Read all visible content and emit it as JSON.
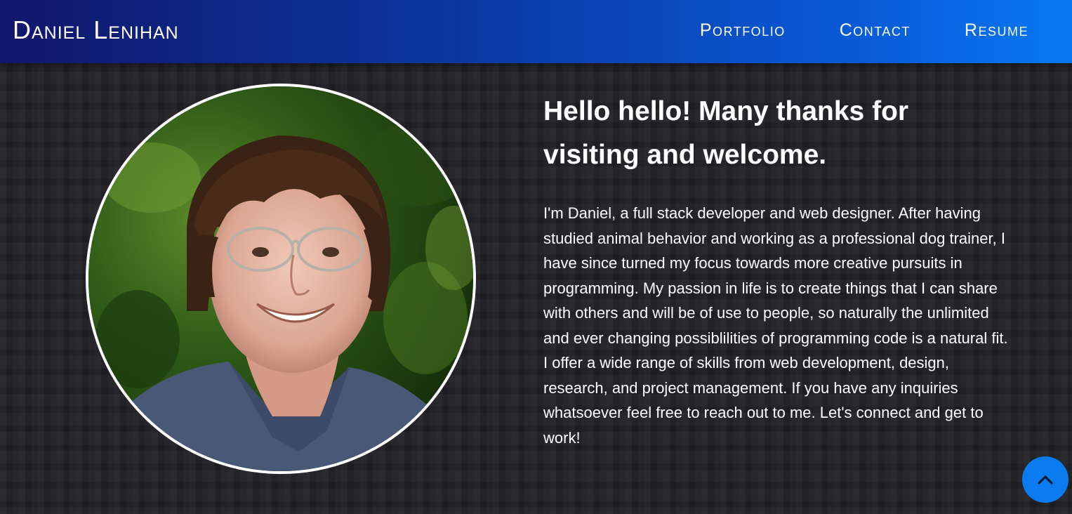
{
  "header": {
    "brand": "Daniel Lenihan",
    "nav": [
      {
        "label": "Portfolio"
      },
      {
        "label": "Contact"
      },
      {
        "label": "Resume"
      }
    ]
  },
  "intro": {
    "headline": "Hello hello! Many thanks for visiting and welcome.",
    "bio": "I'm Daniel, a full stack developer and web designer. After having studied animal behavior and working as a professional dog trainer, I have since turned my focus towards more creative pursuits in programming. My passion in life is to create things that I can share with others and will be of use to people, so naturally the unlimited and ever changing possiblilities of programming code is a natural fit. I offer a wide range of skills from web development, design, research, and project management. If you have any inquiries whatsoever feel free to reach out to me. Let's connect and get to work!"
  },
  "icons": {
    "scroll_top": "chevron-up-icon"
  },
  "colors": {
    "header_start": "#12166a",
    "header_end": "#0878f4",
    "background": "#212126",
    "accent": "#0a7cf0"
  }
}
